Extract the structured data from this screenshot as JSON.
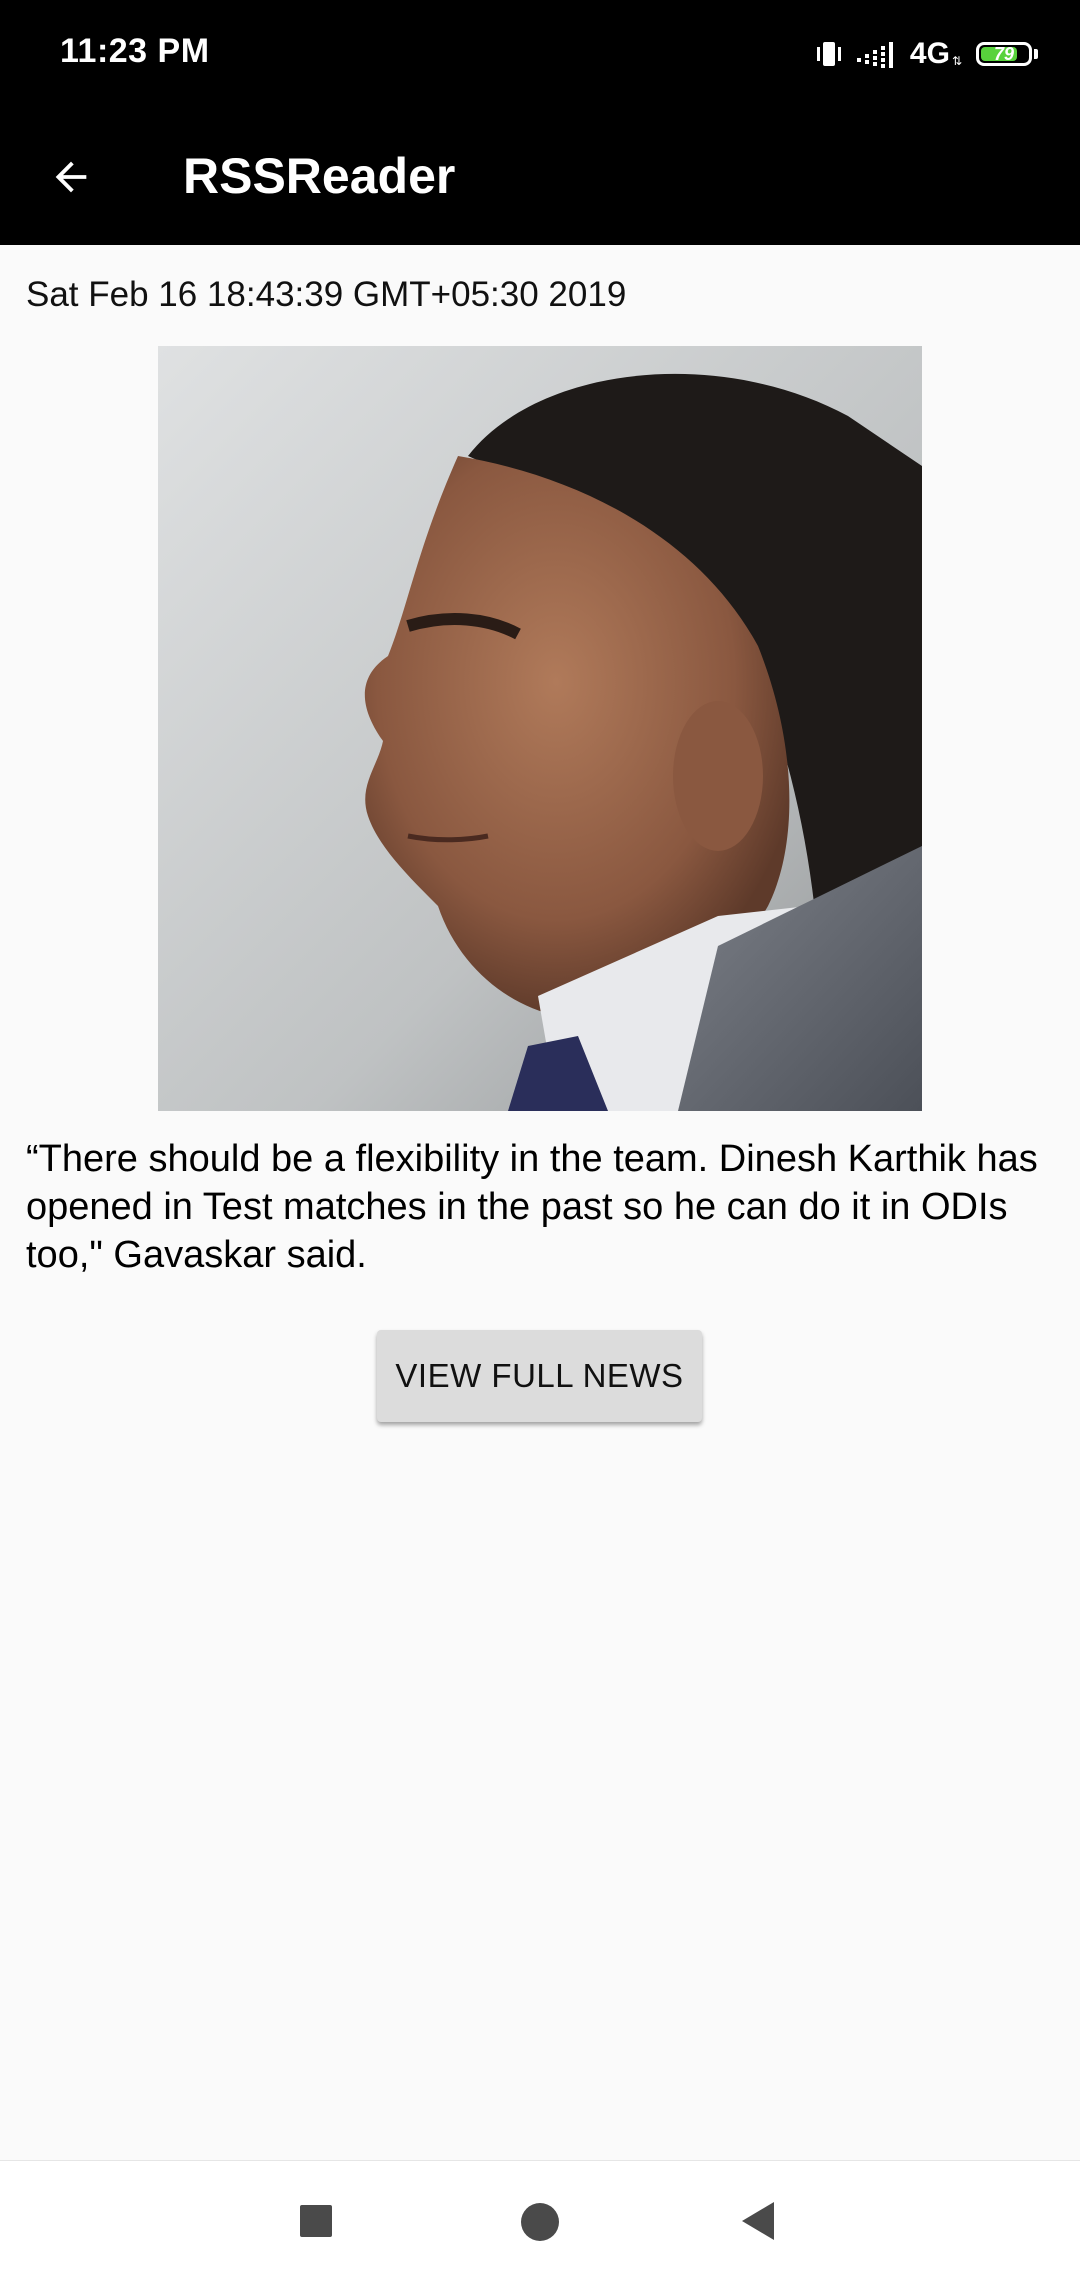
{
  "status_bar": {
    "time": "11:23 PM",
    "network": "4G",
    "battery_level": "79",
    "icons": [
      "vibrate-icon",
      "signal-icon",
      "battery-icon"
    ]
  },
  "app_bar": {
    "title": "RSSReader",
    "back_icon": "arrow-back-icon"
  },
  "article": {
    "date": "Sat Feb 16 18:43:39 GMT+05:30 2019",
    "description": " “There should be a flexibility in the team. Dinesh Karthik has opened in Test matches in the past so he can do it in ODIs too,\" Gavaskar said.",
    "view_full_label": "VIEW FULL NEWS"
  },
  "nav_bar": {
    "icons": [
      "recent-apps-icon",
      "home-icon",
      "back-icon"
    ]
  },
  "colors": {
    "app_bar_bg": "#000000",
    "page_bg": "#fafafa",
    "button_bg": "#dcdcdc",
    "battery_fill": "#58d23c"
  }
}
